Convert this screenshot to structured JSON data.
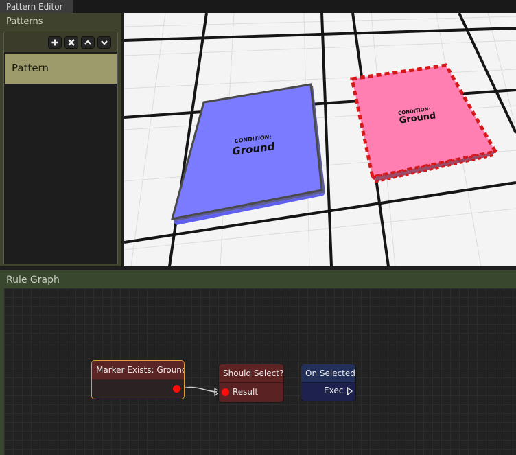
{
  "window": {
    "tab_title": "Pattern Editor"
  },
  "patterns_panel": {
    "title": "Patterns",
    "toolbar": [
      {
        "name": "add-pattern-button",
        "icon": "plus-icon"
      },
      {
        "name": "remove-pattern-button",
        "icon": "close-icon"
      },
      {
        "name": "move-up-button",
        "icon": "chevron-up-icon"
      },
      {
        "name": "move-down-button",
        "icon": "chevron-down-icon"
      }
    ],
    "items": [
      {
        "label": "Pattern",
        "selected": true
      }
    ]
  },
  "viewport": {
    "markers": [
      {
        "caption": "CONDITION:",
        "value": "Ground",
        "color": "#7b7bff",
        "selected": false
      },
      {
        "caption": "CONDITION:",
        "value": "Ground",
        "color": "#ff7fb3",
        "selected": true,
        "outline_color": "#e81515"
      }
    ]
  },
  "rule_graph": {
    "title": "Rule Graph",
    "nodes": {
      "marker_exists": {
        "title": "Marker Exists: Ground"
      },
      "should_select": {
        "title": "Should Select?",
        "input_label": "Result"
      },
      "on_selected": {
        "title": "On Selected",
        "output_label": "Exec"
      }
    }
  },
  "colors": {
    "panel_olive": "#3f422c",
    "selection": "#9d9b6c",
    "graph_panel": "#39472f",
    "port_red": "#ff0c0c",
    "node_highlight": "#e09a3a"
  }
}
